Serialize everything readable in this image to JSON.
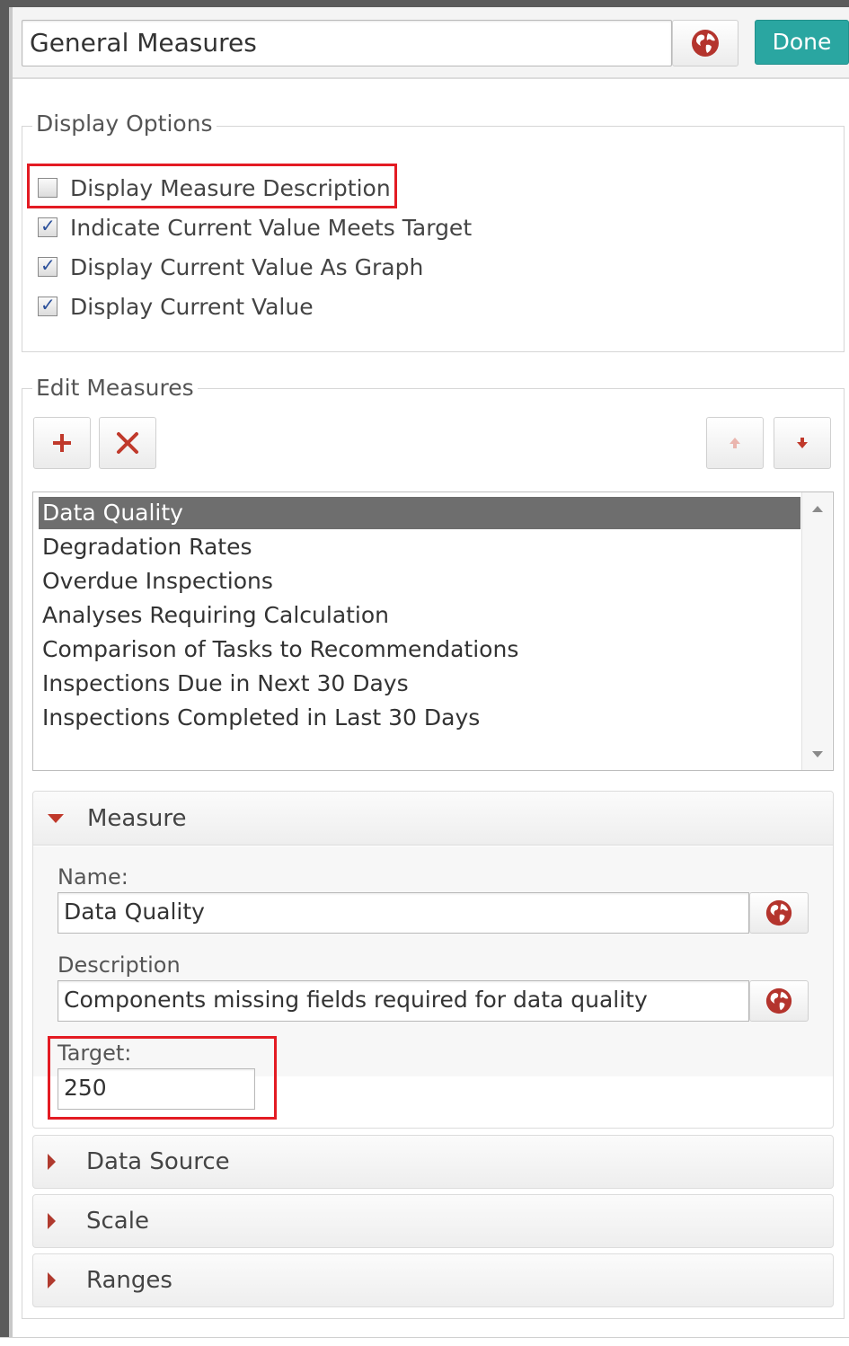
{
  "header": {
    "title_value": "General Measures",
    "done_label": "Done"
  },
  "display_options": {
    "legend": "Display Options",
    "items": [
      {
        "label": "Display Measure Description",
        "checked": false
      },
      {
        "label": "Indicate Current Value Meets Target",
        "checked": true
      },
      {
        "label": "Display Current Value As Graph",
        "checked": true
      },
      {
        "label": "Display Current Value",
        "checked": true
      }
    ]
  },
  "edit_measures": {
    "legend": "Edit Measures",
    "toolbar_icons": [
      "add-icon",
      "remove-icon",
      "move-up-icon",
      "move-down-icon"
    ],
    "list": [
      "Data Quality",
      "Degradation Rates",
      "Overdue Inspections",
      "Analyses Requiring Calculation",
      "Comparison of Tasks to Recommendations",
      "Inspections Due in Next 30 Days",
      "Inspections Completed in Last 30 Days"
    ],
    "selected_index": 0
  },
  "measure_section": {
    "title": "Measure",
    "name_label": "Name:",
    "name_value": "Data Quality",
    "description_label": "Description",
    "description_value": "Components missing fields required for data quality",
    "target_label": "Target:",
    "target_value": "250"
  },
  "sections": {
    "data_source": "Data Source",
    "scale": "Scale",
    "ranges": "Ranges"
  },
  "colors": {
    "accent": "#2aa6a1",
    "highlight": "#e31b23",
    "selected_row": "#6e6e6e"
  }
}
